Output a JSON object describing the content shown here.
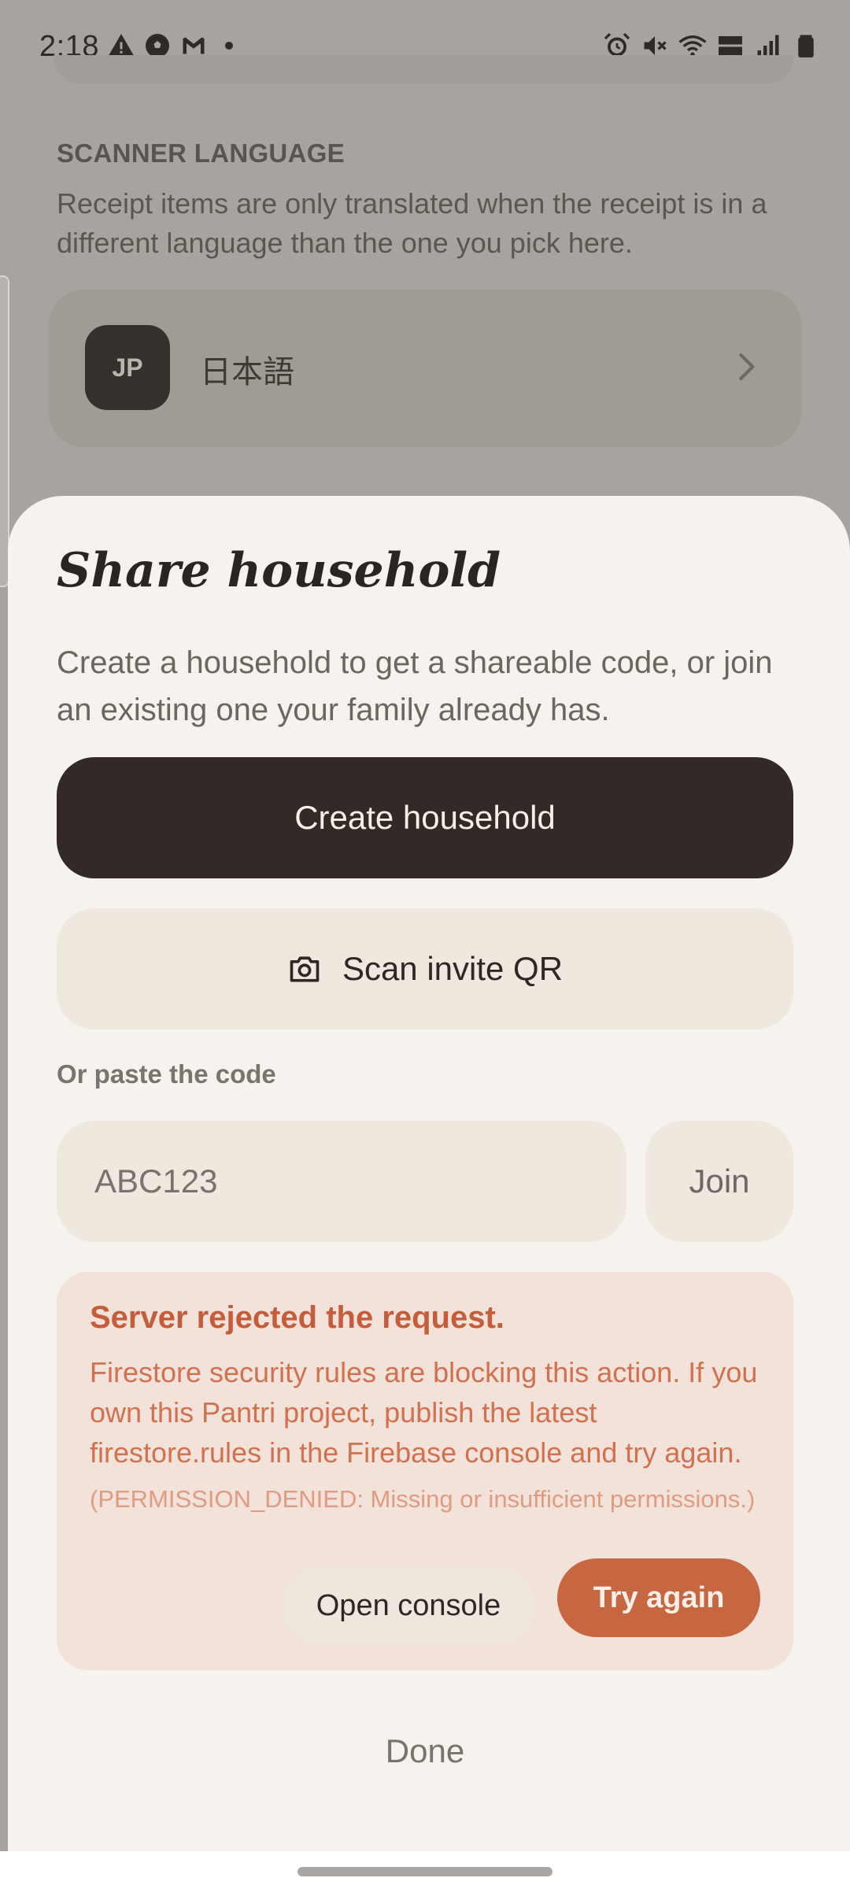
{
  "status_bar": {
    "time": "2:18",
    "left_icons": [
      "warning-icon",
      "soccer-ball-icon",
      "gmail-icon",
      "notification-dot"
    ],
    "right_icons": [
      "alarm-icon",
      "mute-icon",
      "wifi-icon",
      "volte-icon",
      "signal-icon",
      "battery-icon"
    ]
  },
  "background": {
    "section_title": "SCANNER LANGUAGE",
    "section_desc": "Receipt items are only translated when the receipt is in a different language than the one you pick here.",
    "language": {
      "badge": "JP",
      "name": "日本語"
    }
  },
  "sheet": {
    "title": "Share household",
    "description": "Create a household to get a shareable code, or join an existing one your family already has.",
    "create_label": "Create household",
    "scan_label": "Scan invite QR",
    "paste_label": "Or paste the code",
    "code_placeholder": "ABC123",
    "join_label": "Join",
    "error": {
      "title": "Server rejected the request.",
      "body": "Firestore security rules are blocking this action. If you own this Pantri project, publish the latest firestore.rules in the Firebase console and try again.",
      "code": "(PERMISSION_DENIED: Missing or insufficient permissions.)",
      "open_console_label": "Open console",
      "try_again_label": "Try again"
    },
    "done_label": "Done"
  },
  "colors": {
    "accent": "#c76742",
    "primary_button": "#332a27",
    "sheet_bg": "#f6f2ed",
    "error_bg": "#f2e2da",
    "error_text": "#c45d3b"
  }
}
